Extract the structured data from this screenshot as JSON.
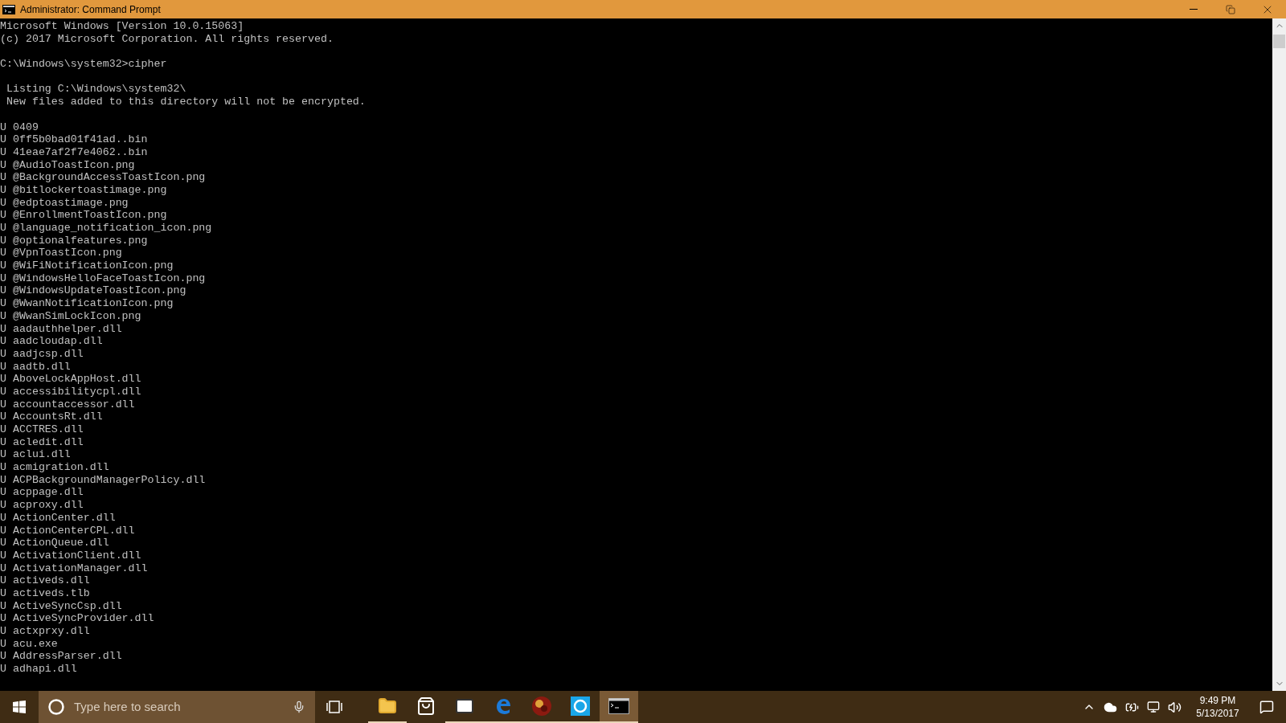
{
  "window": {
    "title": "Administrator: Command Prompt"
  },
  "console": {
    "banner": [
      "Microsoft Windows [Version 10.0.15063]",
      "(c) 2017 Microsoft Corporation. All rights reserved."
    ],
    "prompt": "C:\\Windows\\system32>cipher",
    "listing": [
      " Listing C:\\Windows\\system32\\",
      " New files added to this directory will not be encrypted."
    ],
    "entries": [
      "U 0409",
      "U 0ff5b0bad01f41ad..bin",
      "U 41eae7af2f7e4062..bin",
      "U @AudioToastIcon.png",
      "U @BackgroundAccessToastIcon.png",
      "U @bitlockertoastimage.png",
      "U @edptoastimage.png",
      "U @EnrollmentToastIcon.png",
      "U @language_notification_icon.png",
      "U @optionalfeatures.png",
      "U @VpnToastIcon.png",
      "U @WiFiNotificationIcon.png",
      "U @WindowsHelloFaceToastIcon.png",
      "U @WindowsUpdateToastIcon.png",
      "U @WwanNotificationIcon.png",
      "U @WwanSimLockIcon.png",
      "U aadauthhelper.dll",
      "U aadcloudap.dll",
      "U aadjcsp.dll",
      "U aadtb.dll",
      "U AboveLockAppHost.dll",
      "U accessibilitycpl.dll",
      "U accountaccessor.dll",
      "U AccountsRt.dll",
      "U ACCTRES.dll",
      "U acledit.dll",
      "U aclui.dll",
      "U acmigration.dll",
      "U ACPBackgroundManagerPolicy.dll",
      "U acppage.dll",
      "U acproxy.dll",
      "U ActionCenter.dll",
      "U ActionCenterCPL.dll",
      "U ActionQueue.dll",
      "U ActivationClient.dll",
      "U ActivationManager.dll",
      "U activeds.dll",
      "U activeds.tlb",
      "U ActiveSyncCsp.dll",
      "U ActiveSyncProvider.dll",
      "U actxprxy.dll",
      "U acu.exe",
      "U AddressParser.dll",
      "U adhapi.dll"
    ]
  },
  "taskbar": {
    "search": {
      "placeholder": "Type here to search"
    },
    "apps": [
      {
        "kind": "explorer",
        "running": true,
        "selected": false
      },
      {
        "kind": "store",
        "running": false,
        "selected": false
      },
      {
        "kind": "mail",
        "running": true,
        "selected": false
      },
      {
        "kind": "edge",
        "running": true,
        "selected": false
      },
      {
        "kind": "game",
        "running": true,
        "selected": false
      },
      {
        "kind": "skype",
        "running": true,
        "selected": false
      },
      {
        "kind": "terminal",
        "running": true,
        "selected": true
      }
    ],
    "clock": {
      "time": "9:49 PM",
      "date": "5/13/2017"
    }
  }
}
